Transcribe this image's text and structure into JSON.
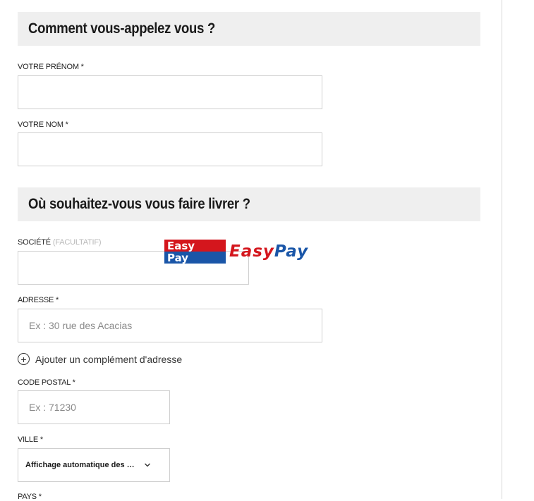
{
  "section_name": {
    "title": "Comment vous-appelez vous ?",
    "first_name_label": "VOTRE PRÉNOM *",
    "first_name_value": "",
    "last_name_label": "VOTRE NOM *",
    "last_name_value": ""
  },
  "section_delivery": {
    "title": "Où souhaitez-vous vous faire livrer ?",
    "company_label": "SOCIÉTÉ",
    "company_optional": "(FACULTATIF)",
    "company_value": "",
    "address_label": "ADRESSE *",
    "address_placeholder": "Ex : 30 rue des Acacias",
    "add_complement": "Ajouter un complément d'adresse",
    "postal_label": "CODE POSTAL *",
    "postal_placeholder": "Ex : 71230",
    "city_label": "VILLE *",
    "city_select_value": "Affichage automatique des vil...",
    "country_label": "PAYS *"
  },
  "overlay_logo": {
    "badge_line1": "Easy",
    "badge_line2": "Pay",
    "word_part1": "Easy",
    "word_part2": "Pay",
    "color_red": "#d4161d",
    "color_blue": "#1a56a8"
  },
  "icons": {
    "add": "plus-circle-icon",
    "dropdown": "chevron-down-icon"
  }
}
